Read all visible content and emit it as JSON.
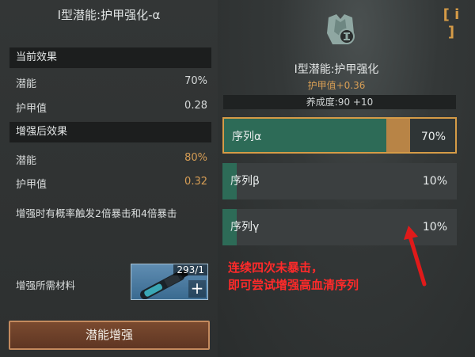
{
  "left": {
    "title": "Ⅰ型潜能:护甲强化-α",
    "current": {
      "header": "当前效果",
      "rows": [
        {
          "label": "潜能",
          "value": "70%"
        },
        {
          "label": "护甲值",
          "value": "0.28"
        }
      ]
    },
    "after": {
      "header": "增强后效果",
      "rows": [
        {
          "label": "潜能",
          "value": "80%"
        },
        {
          "label": "护甲值",
          "value": "0.32"
        }
      ]
    },
    "note": "增强时有概率触发2倍暴击和4倍暴击",
    "material_label": "增强所需材料",
    "material_count": "293/1",
    "material_plus": "+",
    "enhance_button": "潜能增强"
  },
  "right": {
    "info": "[ i ]",
    "title": "Ⅰ型潜能:护甲强化",
    "subtitle": "护甲值+0.36",
    "level": "养成度:90  +10",
    "sequences": [
      {
        "name": "序列α",
        "pct": "70%",
        "fill": 0.7
      },
      {
        "name": "序列β",
        "pct": "10%",
        "fill": 0.1
      },
      {
        "name": "序列γ",
        "pct": "10%",
        "fill": 0.1
      }
    ],
    "annotation": [
      "连续四次未暴击，",
      "即可尝试增强高血清序列"
    ]
  },
  "colors": {
    "accent_orange": "#d79e55",
    "seq_green": "#2d6b57",
    "annotation_red": "#ff2a2a"
  }
}
